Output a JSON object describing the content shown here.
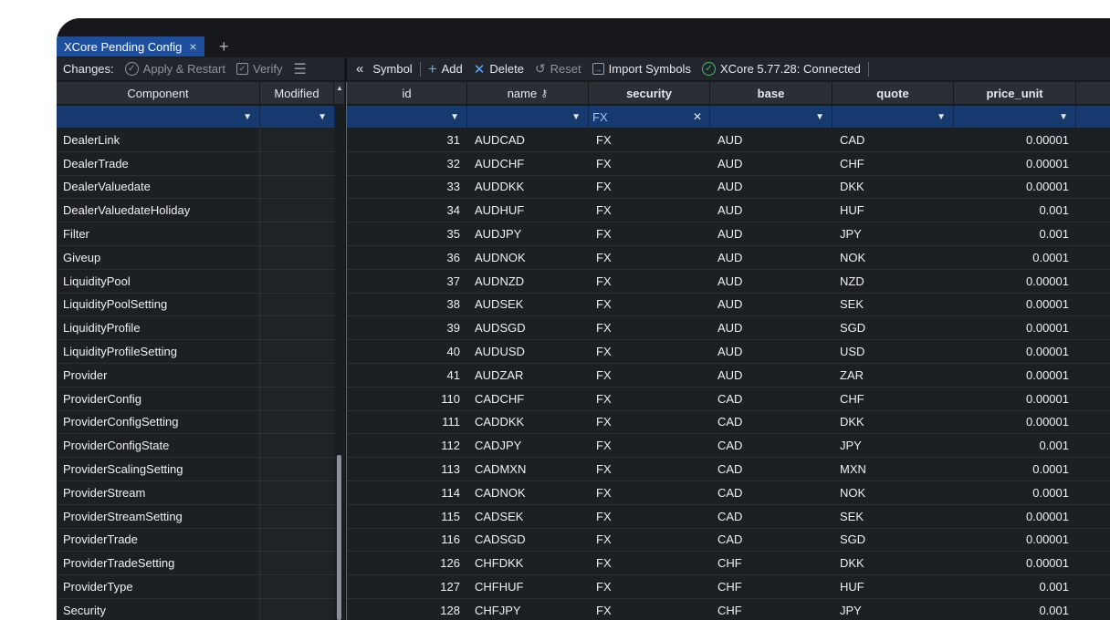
{
  "window": {
    "tab_label": "XCore Pending Config",
    "tab_close": "×",
    "tab_add": "+"
  },
  "left_toolbar": {
    "changes_label": "Changes:",
    "apply_label": "Apply & Restart",
    "verify_label": "Verify"
  },
  "right_toolbar": {
    "symbol_label": "Symbol",
    "add_label": "Add",
    "delete_label": "Delete",
    "reset_label": "Reset",
    "import_label": "Import Symbols",
    "status_label": "XCore 5.77.28: Connected"
  },
  "left_table": {
    "headers": [
      "Component",
      "Modified"
    ],
    "rows": [
      "DealerLink",
      "DealerTrade",
      "DealerValuedate",
      "DealerValuedateHoliday",
      "Filter",
      "Giveup",
      "LiquidityPool",
      "LiquidityPoolSetting",
      "LiquidityProfile",
      "LiquidityProfileSetting",
      "Provider",
      "ProviderConfig",
      "ProviderConfigSetting",
      "ProviderConfigState",
      "ProviderScalingSetting",
      "ProviderStream",
      "ProviderStreamSetting",
      "ProviderTrade",
      "ProviderTradeSetting",
      "ProviderType",
      "Security"
    ]
  },
  "right_table": {
    "headers": [
      "id",
      "name",
      "security",
      "base",
      "quote",
      "price_unit"
    ],
    "security_filter": "FX",
    "rows": [
      [
        "31",
        "AUDCAD",
        "FX",
        "AUD",
        "CAD",
        "0.00001"
      ],
      [
        "32",
        "AUDCHF",
        "FX",
        "AUD",
        "CHF",
        "0.00001"
      ],
      [
        "33",
        "AUDDKK",
        "FX",
        "AUD",
        "DKK",
        "0.00001"
      ],
      [
        "34",
        "AUDHUF",
        "FX",
        "AUD",
        "HUF",
        "0.001"
      ],
      [
        "35",
        "AUDJPY",
        "FX",
        "AUD",
        "JPY",
        "0.001"
      ],
      [
        "36",
        "AUDNOK",
        "FX",
        "AUD",
        "NOK",
        "0.0001"
      ],
      [
        "37",
        "AUDNZD",
        "FX",
        "AUD",
        "NZD",
        "0.00001"
      ],
      [
        "38",
        "AUDSEK",
        "FX",
        "AUD",
        "SEK",
        "0.00001"
      ],
      [
        "39",
        "AUDSGD",
        "FX",
        "AUD",
        "SGD",
        "0.00001"
      ],
      [
        "40",
        "AUDUSD",
        "FX",
        "AUD",
        "USD",
        "0.00001"
      ],
      [
        "41",
        "AUDZAR",
        "FX",
        "AUD",
        "ZAR",
        "0.00001"
      ],
      [
        "110",
        "CADCHF",
        "FX",
        "CAD",
        "CHF",
        "0.00001"
      ],
      [
        "111",
        "CADDKK",
        "FX",
        "CAD",
        "DKK",
        "0.00001"
      ],
      [
        "112",
        "CADJPY",
        "FX",
        "CAD",
        "JPY",
        "0.001"
      ],
      [
        "113",
        "CADMXN",
        "FX",
        "CAD",
        "MXN",
        "0.0001"
      ],
      [
        "114",
        "CADNOK",
        "FX",
        "CAD",
        "NOK",
        "0.0001"
      ],
      [
        "115",
        "CADSEK",
        "FX",
        "CAD",
        "SEK",
        "0.00001"
      ],
      [
        "116",
        "CADSGD",
        "FX",
        "CAD",
        "SGD",
        "0.00001"
      ],
      [
        "126",
        "CHFDKK",
        "FX",
        "CHF",
        "DKK",
        "0.00001"
      ],
      [
        "127",
        "CHFHUF",
        "FX",
        "CHF",
        "HUF",
        "0.001"
      ],
      [
        "128",
        "CHFJPY",
        "FX",
        "CHF",
        "JPY",
        "0.001"
      ]
    ]
  },
  "colors": {
    "tab_active": "#1e4f9c",
    "filter_row": "#173a6e",
    "accent_green": "#3fbf6b",
    "accent_blue": "#5aa8ff"
  }
}
